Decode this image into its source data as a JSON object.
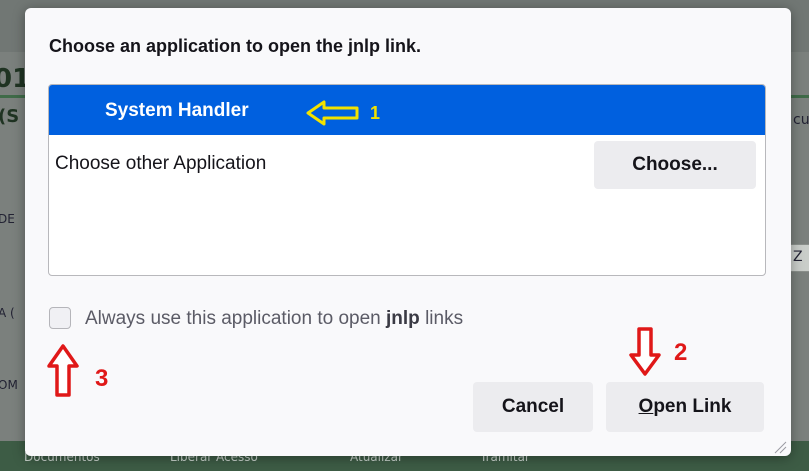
{
  "dialog": {
    "title": "Choose an application to open the jnlp link.",
    "selected_app": "System Handler",
    "other_app_label": "Choose other Application",
    "choose_button": "Choose...",
    "remember_prefix": "Always use this application to open ",
    "remember_bold": "jnlp",
    "remember_suffix": " links",
    "remember_checked": false,
    "cancel_button": "Cancel",
    "open_button_mnemonic": "O",
    "open_button_rest": "pen Link"
  },
  "annotations": {
    "step_1": "1",
    "step_2": "2",
    "step_3": "3",
    "color_yellow": "#f2e200",
    "color_red": "#e01818"
  },
  "background": {
    "bottom_tabs": [
      "Documentos",
      "Liberar Acesso",
      "Atualizar",
      "Tramitar"
    ],
    "fragments": [
      "01",
      "(S",
      "DE",
      "A (",
      "OM",
      "cu",
      "Z"
    ]
  }
}
